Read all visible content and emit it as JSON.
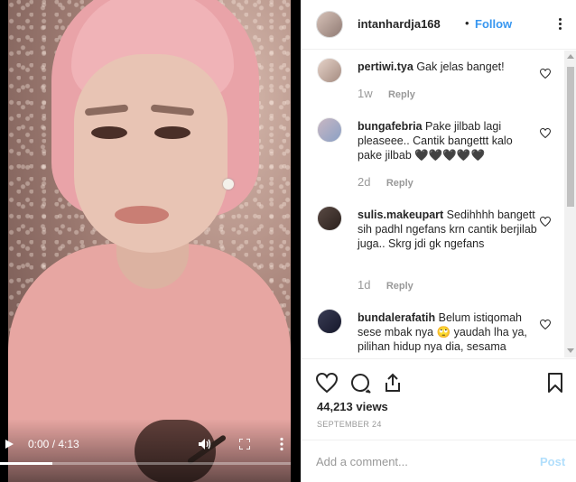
{
  "video": {
    "time": "0:00 / 4:13",
    "progress": 0.18,
    "icons": {
      "play": "play-icon",
      "volume": "volume-icon",
      "fullscreen": "fullscreen-icon",
      "more": "more-vertical-icon"
    }
  },
  "header": {
    "username": "intanhardja168",
    "separator": "•",
    "follow_label": "Follow"
  },
  "comments": [
    {
      "username": "pertiwi.tya",
      "text": "Gak jelas banget!",
      "age": "1w",
      "reply_label": "Reply"
    },
    {
      "username": "bungafebria",
      "text": "Pake jilbab lagi pleaseee.. Cantik bangettt kalo pake jilbab 🖤🖤🖤🖤🖤",
      "age": "2d",
      "reply_label": "Reply"
    },
    {
      "username": "sulis.makeupart",
      "text": "Sedihhhh bangett sih padhl ngefans krn cantik berjilab juga.. Skrg jdi gk ngefans",
      "age": "1d",
      "reply_label": "Reply"
    },
    {
      "username": "bundalerafatih",
      "text": "Belum istiqomah sese mbak nya 🙄 yaudah lha ya, pilihan hidup nya dia, sesama",
      "age": "",
      "reply_label": ""
    }
  ],
  "actions": {
    "views": "44,213 views",
    "date": "SEPTEMBER 24"
  },
  "add_comment": {
    "placeholder": "Add a comment...",
    "post_label": "Post"
  },
  "colors": {
    "link_blue": "#3897f0",
    "post_disabled": "#b2dffc",
    "meta_gray": "#999999",
    "text": "#262626"
  }
}
